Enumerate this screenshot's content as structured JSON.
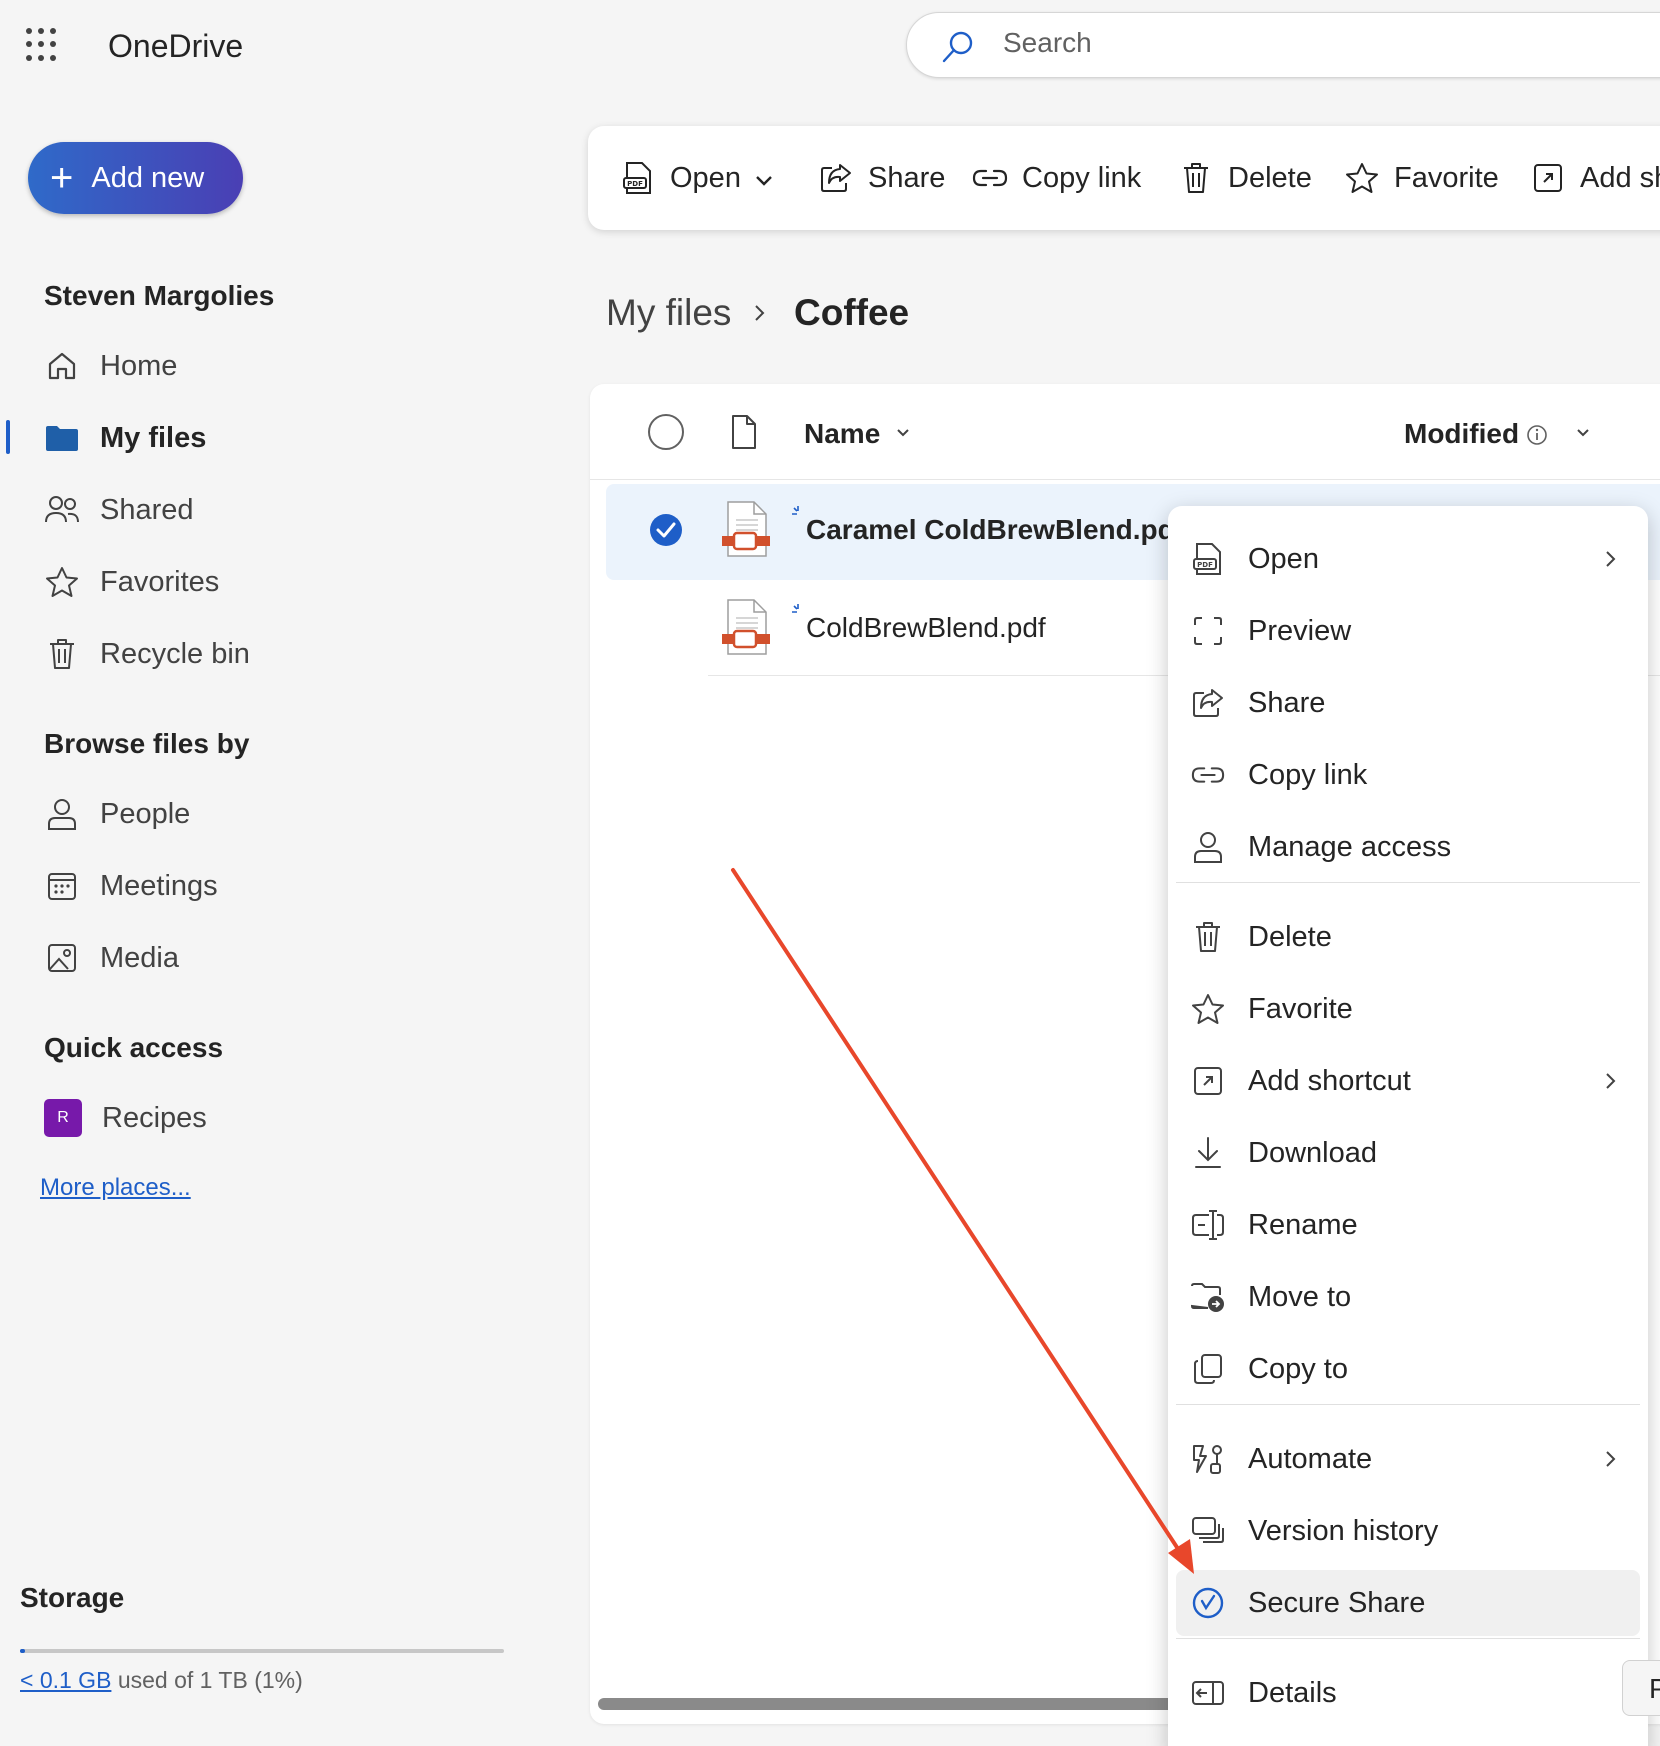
{
  "app": {
    "title": "OneDrive"
  },
  "search": {
    "placeholder": "Search"
  },
  "sidebar": {
    "add_new": "Add new",
    "user_name": "Steven Margolies",
    "nav": [
      "Home",
      "My files",
      "Shared",
      "Favorites",
      "Recycle bin"
    ],
    "active": "My files",
    "browse_heading": "Browse files by",
    "browse": [
      "People",
      "Meetings",
      "Media"
    ],
    "quick_access_heading": "Quick access",
    "quick_access": [
      {
        "badge": "R",
        "label": "Recipes"
      }
    ],
    "more_places": "More places...",
    "storage": {
      "title": "Storage",
      "used": "< 0.1 GB",
      "suffix": "used of 1 TB (1%)",
      "fraction": 0.01
    }
  },
  "toolbar": {
    "open": "Open",
    "share": "Share",
    "copy_link": "Copy link",
    "delete": "Delete",
    "favorite": "Favorite",
    "add_shortcut": "Add sh"
  },
  "breadcrumb": {
    "root": "My files",
    "current": "Coffee"
  },
  "file_list": {
    "columns": {
      "name": "Name",
      "modified": "Modified"
    },
    "files": [
      {
        "name": "Caramel ColdBrewBlend.pdf",
        "selected": true
      },
      {
        "name": "ColdBrewBlend.pdf",
        "selected": false
      }
    ]
  },
  "context_menu": {
    "items": [
      "Open",
      "Preview",
      "Share",
      "Copy link",
      "Manage access",
      "Delete",
      "Favorite",
      "Add shortcut",
      "Download",
      "Rename",
      "Move to",
      "Copy to",
      "Automate",
      "Version history",
      "Secure Share",
      "Details"
    ],
    "highlighted": "Secure Share"
  },
  "edge_button": "P",
  "colors": {
    "accent": "#1e5ec8",
    "selected_row": "#ebf3fc",
    "annotation_arrow": "#e8472b",
    "pdf_red": "#d1502c"
  }
}
